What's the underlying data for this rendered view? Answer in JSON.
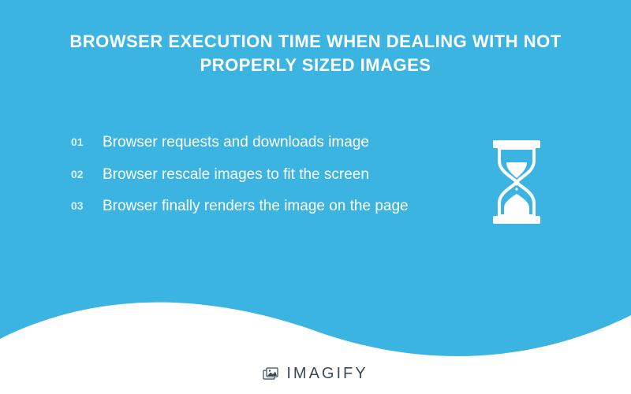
{
  "title": "BROWSER EXECUTION TIME WHEN DEALING WITH NOT PROPERLY SIZED IMAGES",
  "steps": [
    {
      "num": "01",
      "text": "Browser requests and downloads image"
    },
    {
      "num": "02",
      "text": "Browser rescale images to fit the screen"
    },
    {
      "num": "03",
      "text": "Browser finally renders the image on the page"
    }
  ],
  "brand": "IMAGIFY",
  "colors": {
    "bg": "#3cb4e1",
    "text": "#ffffff",
    "brand_text": "#3a4a57"
  }
}
